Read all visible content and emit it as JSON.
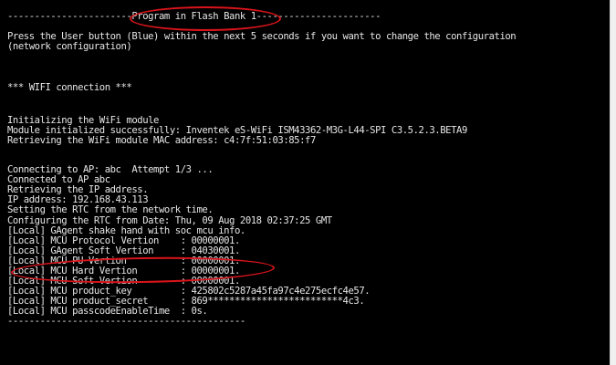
{
  "terminal": {
    "lines": [
      "-----------------------Program in Flash Bank 1-----------------------",
      "Press the User button (Blue) within the next 5 seconds if you want to change the configuration",
      "(network configuration)",
      "",
      "",
      "*** WIFI connection ***",
      "",
      "Initializing the WiFi module",
      "Module initialized successfully: Inventek eS-WiFi ISM43362-M3G-L44-SPI C3.5.2.3.BETA9",
      "Retrieving the WiFi module MAC address: c4:7f:51:03:85:f7",
      "",
      "Connecting to AP: abc  Attempt 1/3 ...",
      "Connected to AP abc",
      "Retrieving the IP address.",
      "IP address: 192.168.43.113",
      "Setting the RTC from the network time.",
      "Configuring the RTC from Date: Thu, 09 Aug 2018 02:37:25 GMT",
      "[Local] GAgent shake hand with soc mcu info.",
      "[Local] MCU Protocol Vertion    : 00000001.",
      "[Local] GAgent Soft Vertion     : 04030001.",
      "[Local] MCU PU Vertion          : 00000001.",
      "[Local] MCU Hard Vertion        : 00000001.",
      "[Local] MCU Soft Vertion        : 00000001.",
      "[Local] MCU product_key         : 425802c5287a45fa97c4e275ecfc4e57.",
      "[Local] MCU product_secret      : 869*************************4c3.",
      "[Local] MCU passcodeEnableTime  : 0s.",
      "--------------------------------------------"
    ]
  },
  "annotations": {
    "color": "#d9141b"
  }
}
